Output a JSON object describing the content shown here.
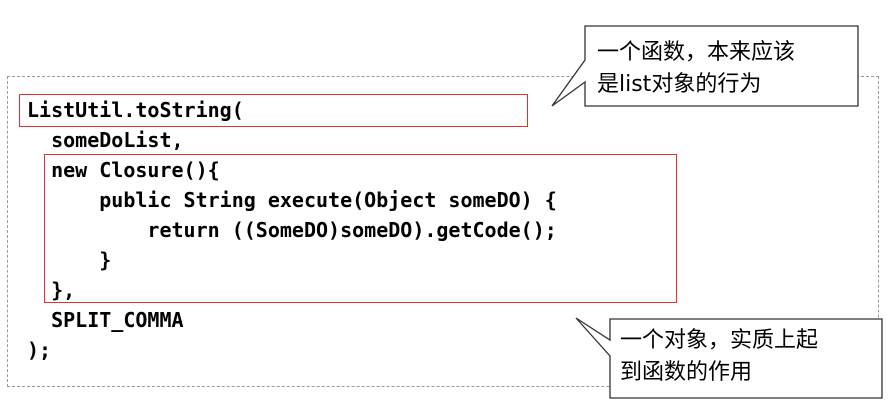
{
  "code": {
    "lines": [
      "ListUtil.toString(",
      "  someDoList,",
      "  new Closure(){",
      "      public String execute(Object someDO) {",
      "          return ((SomeDO)someDO).getCode();",
      "      }",
      "  },",
      "  SPLIT_COMMA",
      ");"
    ]
  },
  "callouts": {
    "top": {
      "line1": "一个函数，本来应该",
      "line2": "是list对象的行为"
    },
    "bottom": {
      "line1": "一个对象，实质上起",
      "line2": "到函数的作用"
    }
  },
  "colors": {
    "highlight": "#e03030",
    "frame": "#9a9a9a",
    "callout_border": "#333333"
  }
}
